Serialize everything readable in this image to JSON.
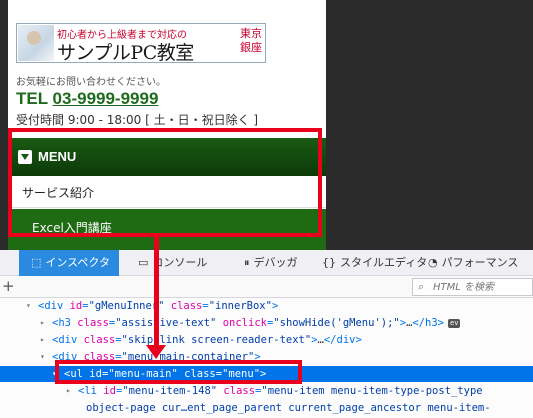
{
  "mobile_page": {
    "banner": {
      "tagline": "初心者から上級者まで対応の",
      "title": "サンプルPC教室",
      "location": "東京 銀座"
    },
    "contact_note": "お気軽にお問い合わせください。",
    "tel_prefix": "TEL",
    "tel_number": "03-9999-9999",
    "hours": "受付時間 9:00 - 18:00 [ 土・日・祝日除く ]",
    "menu_label": "MENU",
    "menu_items": [
      "サービス紹介",
      "Excel入門講座"
    ]
  },
  "devtools": {
    "tabs": [
      {
        "label": "インスペクタ",
        "icon": "inspector-icon"
      },
      {
        "label": "コンソール",
        "icon": "console-icon"
      },
      {
        "label": "デバッガ",
        "icon": "debugger-icon"
      },
      {
        "label": "スタイルエディタ",
        "icon": "style-editor-icon"
      },
      {
        "label": "パフォーマンス",
        "icon": "performance-icon"
      }
    ],
    "search_placeholder": "HTML を検索",
    "lines": [
      {
        "toggle": "▾",
        "parts": [
          {
            "t": "tag",
            "v": "<div "
          },
          {
            "t": "attr",
            "v": "id"
          },
          {
            "t": "tag",
            "v": "="
          },
          {
            "t": "val",
            "v": "\"gMenuInner\""
          },
          {
            "t": "attr",
            "v": " class"
          },
          {
            "t": "tag",
            "v": "="
          },
          {
            "t": "val",
            "v": "\"innerBox\""
          },
          {
            "t": "tag",
            "v": ">"
          }
        ]
      },
      {
        "toggle": "▸",
        "parts": [
          {
            "t": "tag",
            "v": "<h3 "
          },
          {
            "t": "attr",
            "v": "class"
          },
          {
            "t": "tag",
            "v": "="
          },
          {
            "t": "val",
            "v": "\"assistive-text\""
          },
          {
            "t": "attr",
            "v": " onclick"
          },
          {
            "t": "tag",
            "v": "="
          },
          {
            "t": "val",
            "v": "\"showHide('gMenu');\""
          },
          {
            "t": "tag",
            "v": ">"
          },
          {
            "t": "text",
            "v": "…"
          },
          {
            "t": "tag",
            "v": "</h3>"
          }
        ],
        "badge": "ev"
      },
      {
        "toggle": "▸",
        "parts": [
          {
            "t": "tag",
            "v": "<div "
          },
          {
            "t": "attr",
            "v": "class"
          },
          {
            "t": "tag",
            "v": "="
          },
          {
            "t": "val",
            "v": "\"skip-link screen-reader-text\""
          },
          {
            "t": "tag",
            "v": ">"
          },
          {
            "t": "text",
            "v": "…"
          },
          {
            "t": "tag",
            "v": "</div>"
          }
        ]
      },
      {
        "toggle": "▾",
        "parts": [
          {
            "t": "tag",
            "v": "<div "
          },
          {
            "t": "attr",
            "v": "class"
          },
          {
            "t": "tag",
            "v": "="
          },
          {
            "t": "val",
            "v": "\"menu-main-container\""
          },
          {
            "t": "tag",
            "v": ">"
          }
        ]
      },
      {
        "toggle": "▾",
        "selected": true,
        "parts": [
          {
            "t": "tag",
            "v": "<ul "
          },
          {
            "t": "attr",
            "v": "id"
          },
          {
            "t": "tag",
            "v": "="
          },
          {
            "t": "val",
            "v": "\"menu-main\""
          },
          {
            "t": "attr",
            "v": " class"
          },
          {
            "t": "tag",
            "v": "="
          },
          {
            "t": "val",
            "v": "\"menu\""
          },
          {
            "t": "tag",
            "v": ">"
          }
        ]
      },
      {
        "toggle": "▸",
        "parts": [
          {
            "t": "tag",
            "v": "<li "
          },
          {
            "t": "attr",
            "v": "id"
          },
          {
            "t": "tag",
            "v": "="
          },
          {
            "t": "val",
            "v": "\"menu-item-148\""
          },
          {
            "t": "attr",
            "v": " class"
          },
          {
            "t": "tag",
            "v": "="
          },
          {
            "t": "val",
            "v": "\"menu-item menu-item-type-post_type"
          }
        ]
      },
      {
        "toggle": "",
        "parts": [
          {
            "t": "val",
            "v": "object-page cur…ent_page_parent current_page_ancestor menu-item-"
          }
        ]
      }
    ]
  }
}
